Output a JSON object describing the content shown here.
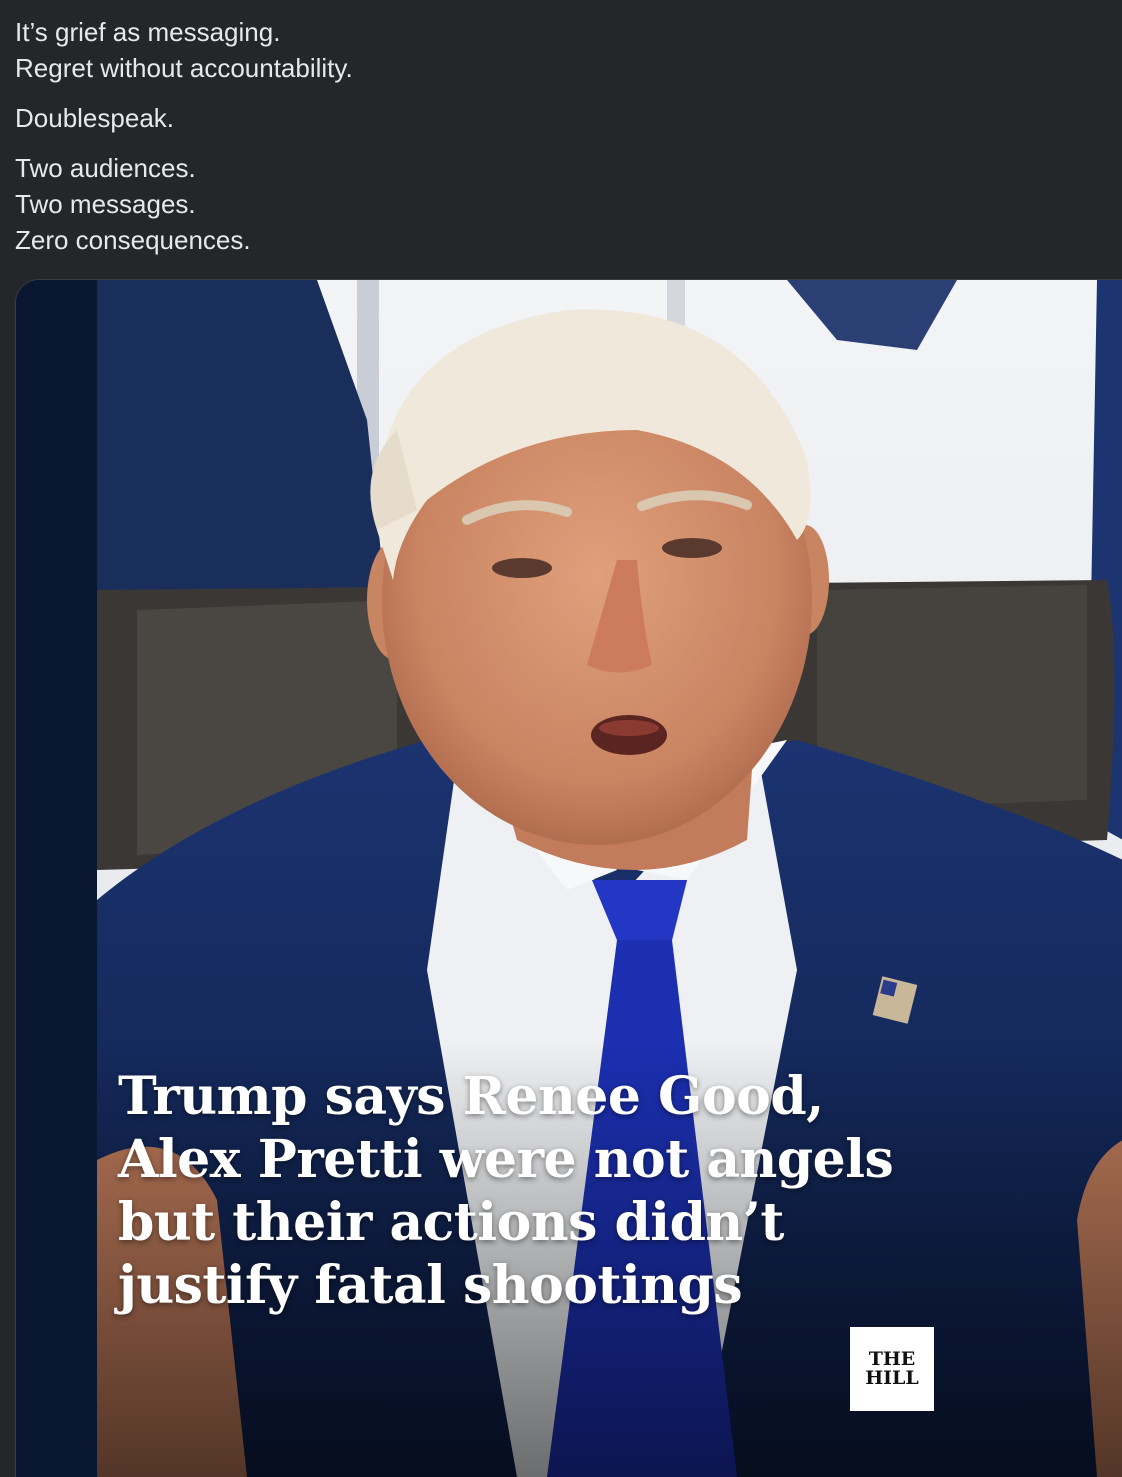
{
  "post": {
    "paragraphs": [
      {
        "lines": [
          "It’s grief as messaging.",
          "Regret without accountability."
        ]
      },
      {
        "lines": [
          "Doublespeak."
        ]
      },
      {
        "lines": [
          "Two audiences.",
          "Two messages.",
          "Zero consequences."
        ]
      }
    ]
  },
  "media": {
    "headline_lines": [
      "Trump says Renee Good,",
      "Alex Pretti were not angels",
      "but their actions didn’t",
      "justify fatal shootings"
    ],
    "logo": {
      "line1": "THE",
      "line2": "HILL"
    }
  },
  "colors": {
    "background": "#25262a",
    "text": "#e7e8ea",
    "suit": "#12275a",
    "tie": "#1b2fb0"
  }
}
